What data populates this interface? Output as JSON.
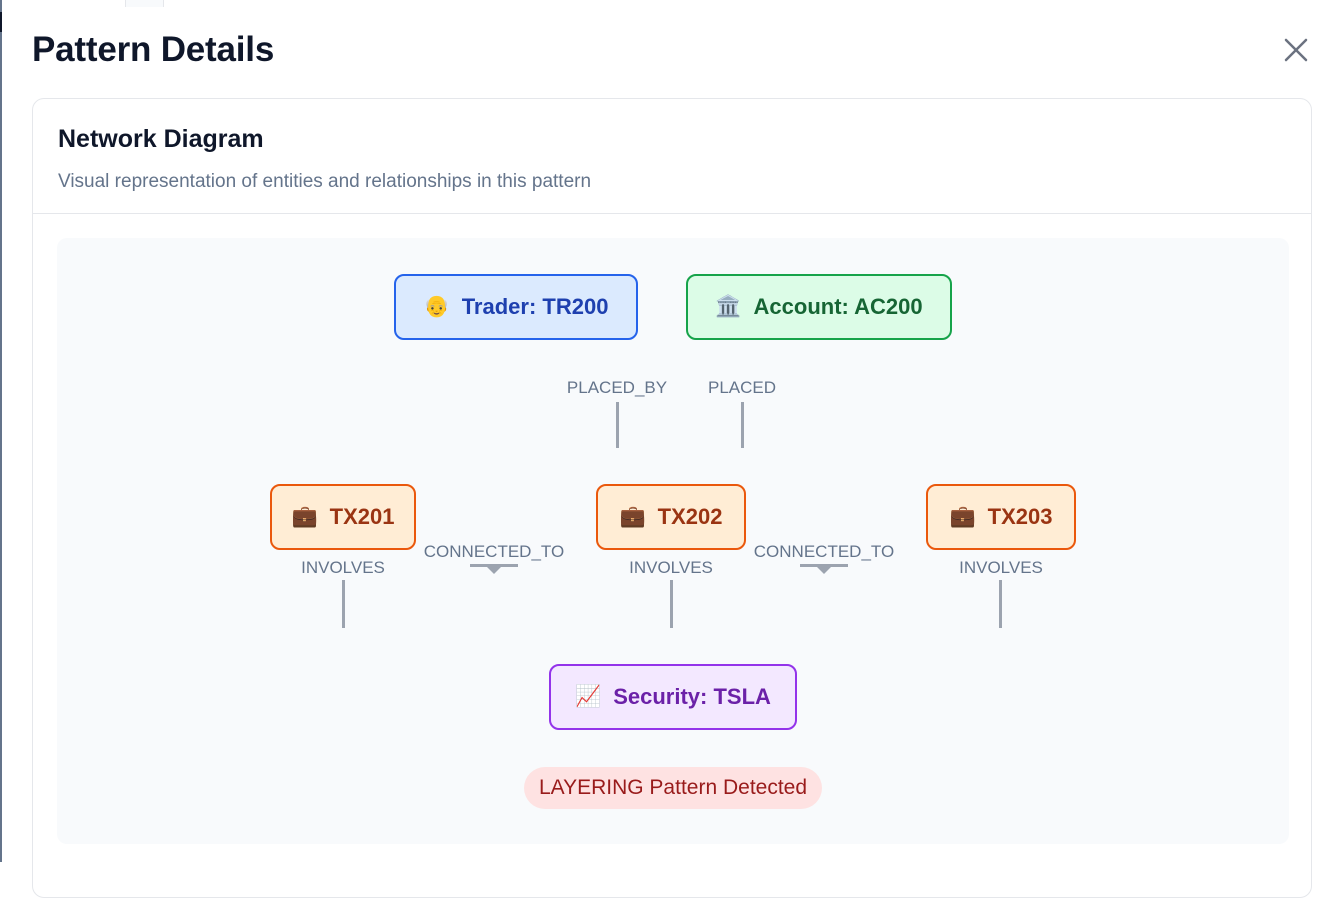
{
  "modal": {
    "title": "Pattern Details",
    "close_icon": "close-icon"
  },
  "card": {
    "title": "Network Diagram",
    "description": "Visual representation of entities and relationships in this pattern"
  },
  "diagram": {
    "nodes": {
      "trader": {
        "icon": "👴",
        "icon_name": "person-icon",
        "label": "Trader: TR200",
        "color": "#2563eb"
      },
      "account": {
        "icon": "🏛️",
        "icon_name": "bank-icon",
        "label": "Account: AC200",
        "color": "#16a34a"
      },
      "tx201": {
        "icon": "💼",
        "icon_name": "briefcase-icon",
        "label": "TX201",
        "color": "#ea580c"
      },
      "tx202": {
        "icon": "💼",
        "icon_name": "briefcase-icon",
        "label": "TX202",
        "color": "#ea580c"
      },
      "tx203": {
        "icon": "💼",
        "icon_name": "briefcase-icon",
        "label": "TX203",
        "color": "#ea580c"
      },
      "security": {
        "icon": "📈",
        "icon_name": "chart-icon",
        "label": "Security: TSLA",
        "color": "#9333ea"
      }
    },
    "edges": {
      "placed_by": "PLACED_BY",
      "placed": "PLACED",
      "connected_to_1": "CONNECTED_TO",
      "connected_to_2": "CONNECTED_TO",
      "involves_1": "INVOLVES",
      "involves_2": "INVOLVES",
      "involves_3": "INVOLVES"
    },
    "pattern_badge": "LAYERING Pattern Detected"
  }
}
